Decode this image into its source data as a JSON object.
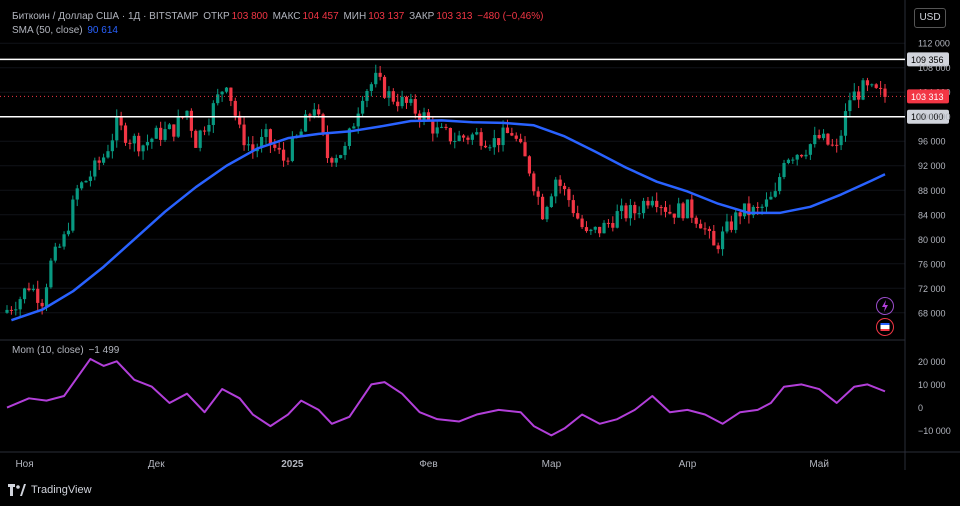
{
  "header": {
    "symbol": "Биткоин / Доллар США · 1Д · BITSTAMP",
    "open_label": "ОТКР",
    "open": "103 800",
    "high_label": "МАКС",
    "high": "104 457",
    "low_label": "МИН",
    "low": "103 137",
    "close_label": "ЗАКР",
    "close": "103 313",
    "change": "−480 (−0,46%)"
  },
  "sma_legend": {
    "label": "SMA (50, close)",
    "value": "90 614"
  },
  "mom_legend": {
    "label": "Mom (10, close)",
    "value": "−1 499"
  },
  "currency_button": "USD",
  "branding": "TradingView",
  "colors": {
    "up": "#089981",
    "down": "#f23645",
    "sma": "#2962ff",
    "mom": "#b23fd9",
    "hline": "#ffffff"
  },
  "icons": [
    "lightning-icon",
    "flag-icon",
    "tradingview-logo-icon"
  ],
  "chart_data": {
    "type": "candlestick",
    "x_ticks": [
      "Ноя",
      "Дек",
      "2025",
      "Фев",
      "Мар",
      "Апр",
      "Май"
    ],
    "price_axis": {
      "ticks": [
        "112 000",
        "108 000",
        "104 000",
        "100 000",
        "96 000",
        "92 000",
        "88 000",
        "84 000",
        "80 000",
        "76 000",
        "72 000",
        "68 000"
      ],
      "ylim": [
        66500,
        113500
      ]
    },
    "horizontal_lines": [
      {
        "value": 109356,
        "label": "109 356"
      },
      {
        "value": 100000,
        "label": "100 000"
      }
    ],
    "last_price": {
      "value": 103313,
      "label": "103 313"
    },
    "close_path": [
      [
        "2024-10-28",
        68500
      ],
      [
        "2024-10-31",
        70500
      ],
      [
        "2024-11-02",
        72500
      ],
      [
        "2024-11-05",
        70200
      ],
      [
        "2024-11-07",
        76000
      ],
      [
        "2024-11-10",
        80000
      ],
      [
        "2024-11-13",
        88000
      ],
      [
        "2024-11-16",
        90500
      ],
      [
        "2024-11-19",
        93500
      ],
      [
        "2024-11-22",
        98500
      ],
      [
        "2024-11-25",
        96500
      ],
      [
        "2024-11-28",
        95500
      ],
      [
        "2024-12-01",
        97000
      ],
      [
        "2024-12-05",
        98000
      ],
      [
        "2024-12-08",
        101000
      ],
      [
        "2024-12-10",
        96000
      ],
      [
        "2024-12-14",
        101500
      ],
      [
        "2024-12-17",
        106000
      ],
      [
        "2024-12-20",
        97500
      ],
      [
        "2024-12-23",
        94500
      ],
      [
        "2024-12-26",
        96500
      ],
      [
        "2024-12-30",
        93000
      ],
      [
        "2025-01-03",
        97500
      ],
      [
        "2025-01-06",
        102000
      ],
      [
        "2025-01-09",
        93500
      ],
      [
        "2025-01-13",
        94500
      ],
      [
        "2025-01-17",
        104000
      ],
      [
        "2025-01-20",
        106000
      ],
      [
        "2025-01-23",
        103500
      ],
      [
        "2025-01-27",
        102000
      ],
      [
        "2025-01-31",
        100000
      ],
      [
        "2025-02-03",
        97500
      ],
      [
        "2025-02-07",
        96500
      ],
      [
        "2025-02-12",
        97000
      ],
      [
        "2025-02-16",
        96000
      ],
      [
        "2025-02-20",
        97500
      ],
      [
        "2025-02-24",
        91500
      ],
      [
        "2025-02-27",
        84500
      ],
      [
        "2025-03-02",
        90000
      ],
      [
        "2025-03-05",
        86500
      ],
      [
        "2025-03-09",
        80500
      ],
      [
        "2025-03-13",
        82000
      ],
      [
        "2025-03-16",
        84000
      ],
      [
        "2025-03-20",
        84500
      ],
      [
        "2025-03-24",
        87500
      ],
      [
        "2025-03-28",
        84500
      ],
      [
        "2025-04-01",
        85000
      ],
      [
        "2025-04-04",
        83000
      ],
      [
        "2025-04-07",
        78500
      ],
      [
        "2025-04-10",
        81500
      ],
      [
        "2025-04-13",
        84500
      ],
      [
        "2025-04-17",
        84500
      ],
      [
        "2025-04-21",
        87000
      ],
      [
        "2025-04-23",
        93500
      ],
      [
        "2025-04-27",
        94500
      ],
      [
        "2025-05-01",
        96500
      ],
      [
        "2025-05-05",
        94500
      ],
      [
        "2025-05-08",
        103000
      ],
      [
        "2025-05-11",
        104500
      ],
      [
        "2025-05-14",
        103800
      ],
      [
        "2025-05-16",
        103313
      ]
    ],
    "sma50": {
      "name": "SMA (50, close)",
      "points": [
        [
          "2024-10-29",
          66800
        ],
        [
          "2024-11-05",
          68500
        ],
        [
          "2024-11-12",
          71500
        ],
        [
          "2024-11-19",
          75500
        ],
        [
          "2024-11-26",
          80000
        ],
        [
          "2024-12-03",
          84500
        ],
        [
          "2024-12-10",
          88500
        ],
        [
          "2024-12-17",
          92000
        ],
        [
          "2024-12-24",
          94800
        ],
        [
          "2024-12-31",
          96500
        ],
        [
          "2025-01-07",
          97200
        ],
        [
          "2025-01-14",
          97600
        ],
        [
          "2025-01-21",
          98400
        ],
        [
          "2025-01-28",
          99300
        ],
        [
          "2025-02-04",
          99400
        ],
        [
          "2025-02-11",
          99100
        ],
        [
          "2025-02-18",
          99000
        ],
        [
          "2025-02-25",
          98600
        ],
        [
          "2025-03-04",
          96800
        ],
        [
          "2025-03-11",
          94300
        ],
        [
          "2025-03-18",
          91700
        ],
        [
          "2025-03-25",
          89400
        ],
        [
          "2025-04-01",
          87800
        ],
        [
          "2025-04-08",
          85800
        ],
        [
          "2025-04-15",
          84300
        ],
        [
          "2025-04-22",
          84300
        ],
        [
          "2025-04-29",
          85300
        ],
        [
          "2025-05-06",
          87300
        ],
        [
          "2025-05-13",
          89600
        ],
        [
          "2025-05-16",
          90614
        ]
      ]
    },
    "momentum": {
      "name": "Mom (10, close)",
      "ticks": [
        "20 000",
        "10 000",
        "0",
        "−10 000"
      ],
      "ylim": [
        -14000,
        24000
      ],
      "points": [
        [
          "2024-10-28",
          0
        ],
        [
          "2024-11-02",
          4000
        ],
        [
          "2024-11-06",
          3000
        ],
        [
          "2024-11-10",
          5000
        ],
        [
          "2024-11-13",
          13000
        ],
        [
          "2024-11-16",
          21000
        ],
        [
          "2024-11-19",
          18000
        ],
        [
          "2024-11-22",
          20000
        ],
        [
          "2024-11-26",
          12000
        ],
        [
          "2024-11-30",
          9000
        ],
        [
          "2024-12-04",
          2000
        ],
        [
          "2024-12-08",
          6000
        ],
        [
          "2024-12-12",
          -2000
        ],
        [
          "2024-12-16",
          8000
        ],
        [
          "2024-12-20",
          4000
        ],
        [
          "2024-12-23",
          -3000
        ],
        [
          "2024-12-27",
          -8000
        ],
        [
          "2024-12-31",
          -3000
        ],
        [
          "2025-01-03",
          3000
        ],
        [
          "2025-01-07",
          -1000
        ],
        [
          "2025-01-10",
          -7000
        ],
        [
          "2025-01-14",
          -4000
        ],
        [
          "2025-01-19",
          10000
        ],
        [
          "2025-01-22",
          11000
        ],
        [
          "2025-01-26",
          6000
        ],
        [
          "2025-01-30",
          -2000
        ],
        [
          "2025-02-03",
          -5000
        ],
        [
          "2025-02-08",
          -6000
        ],
        [
          "2025-02-12",
          -3000
        ],
        [
          "2025-02-17",
          -1000
        ],
        [
          "2025-02-22",
          -2000
        ],
        [
          "2025-02-25",
          -8000
        ],
        [
          "2025-03-01",
          -12000
        ],
        [
          "2025-03-04",
          -9000
        ],
        [
          "2025-03-08",
          -3000
        ],
        [
          "2025-03-12",
          -7000
        ],
        [
          "2025-03-16",
          -5000
        ],
        [
          "2025-03-20",
          -1000
        ],
        [
          "2025-03-24",
          5000
        ],
        [
          "2025-03-28",
          -2000
        ],
        [
          "2025-04-01",
          -1000
        ],
        [
          "2025-04-05",
          -3000
        ],
        [
          "2025-04-09",
          -7000
        ],
        [
          "2025-04-13",
          -2000
        ],
        [
          "2025-04-17",
          -1000
        ],
        [
          "2025-04-20",
          2000
        ],
        [
          "2025-04-23",
          9000
        ],
        [
          "2025-04-27",
          10000
        ],
        [
          "2025-05-01",
          8000
        ],
        [
          "2025-05-05",
          2000
        ],
        [
          "2025-05-09",
          9000
        ],
        [
          "2025-05-12",
          10000
        ],
        [
          "2025-05-16",
          7000
        ]
      ]
    }
  }
}
